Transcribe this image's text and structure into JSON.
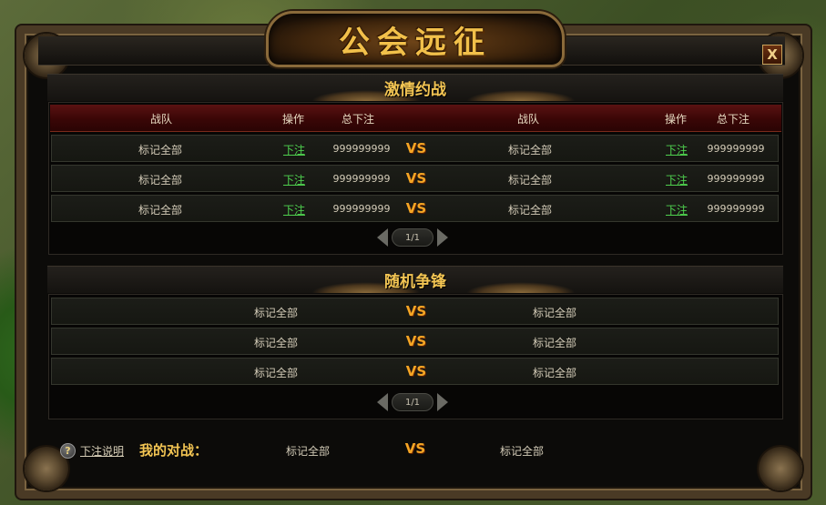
{
  "window": {
    "title": "公会远征",
    "close_label": "X"
  },
  "section1": {
    "title": "激情约战",
    "headers": {
      "team_left": "战队",
      "action_left": "操作",
      "total_left": "总下注",
      "team_right": "战队",
      "action_right": "操作",
      "total_right": "总下注"
    },
    "rows": [
      {
        "left_team": "标记全部",
        "left_bet": "下注",
        "left_total": "999999999",
        "vs": "VS",
        "right_team": "标记全部",
        "right_bet": "下注",
        "right_total": "999999999"
      },
      {
        "left_team": "标记全部",
        "left_bet": "下注",
        "left_total": "999999999",
        "vs": "VS",
        "right_team": "标记全部",
        "right_bet": "下注",
        "right_total": "999999999"
      },
      {
        "left_team": "标记全部",
        "left_bet": "下注",
        "left_total": "999999999",
        "vs": "VS",
        "right_team": "标记全部",
        "right_bet": "下注",
        "right_total": "999999999"
      }
    ],
    "page": "1/1"
  },
  "section2": {
    "title": "随机争锋",
    "rows": [
      {
        "left_team": "标记全部",
        "vs": "VS",
        "right_team": "标记全部"
      },
      {
        "left_team": "标记全部",
        "vs": "VS",
        "right_team": "标记全部"
      },
      {
        "left_team": "标记全部",
        "vs": "VS",
        "right_team": "标记全部"
      }
    ],
    "page": "1/1"
  },
  "footer": {
    "help_icon": "?",
    "help_label": "下注说明",
    "my_battle_label": "我的对战：",
    "left_team": "标记全部",
    "vs": "VS",
    "right_team": "标记全部"
  },
  "icons": {
    "close": "close-icon",
    "help": "question-icon",
    "prev": "arrow-left-icon",
    "next": "arrow-right-icon"
  },
  "colors": {
    "gold_title": "#f3c553",
    "vs": "#f5a524",
    "bet_link": "#4fd24f",
    "header_red": "#5a1212"
  }
}
